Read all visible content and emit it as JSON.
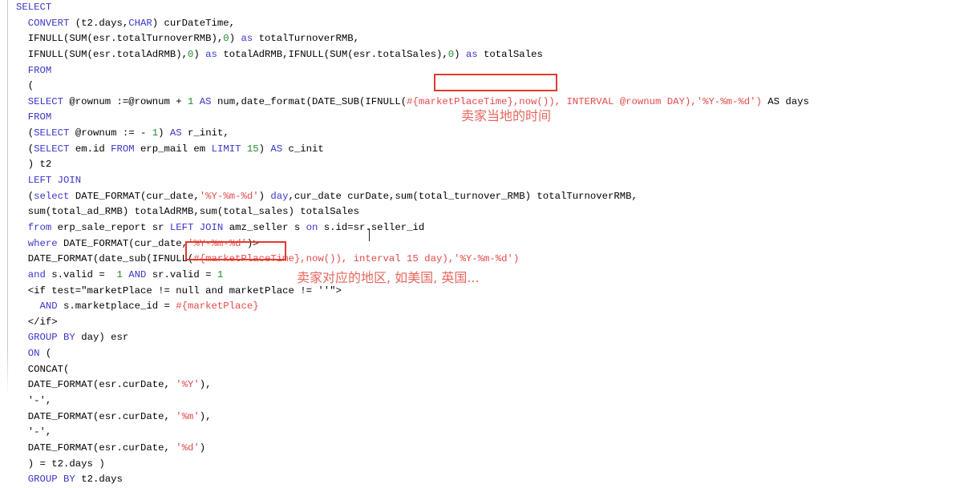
{
  "editor": {
    "language": "SQL / MyBatis XML",
    "background_color": "#ffffff",
    "keyword_color": "#3a36c8",
    "number_color": "#1f8a2e",
    "plain_color": "#000000",
    "placeholder_color": "#e24a4a",
    "annotation_color": "#e7675f",
    "highlight_border_color": "#e23a30"
  },
  "code_lines": [
    {
      "id": "l1",
      "indent": 0,
      "tokens": [
        {
          "t": "SELECT",
          "c": "kw"
        }
      ]
    },
    {
      "id": "l2",
      "indent": 1,
      "tokens": [
        {
          "t": "CONVERT",
          "c": "kw"
        },
        {
          "t": " (t2.days,",
          "c": "pl"
        },
        {
          "t": "CHAR",
          "c": "kw"
        },
        {
          "t": ") curDateTime,",
          "c": "pl"
        }
      ]
    },
    {
      "id": "l3",
      "indent": 1,
      "tokens": [
        {
          "t": "IFNULL(SUM(esr.totalTurnoverRMB),",
          "c": "pl"
        },
        {
          "t": "0",
          "c": "num"
        },
        {
          "t": ") ",
          "c": "pl"
        },
        {
          "t": "as",
          "c": "kw"
        },
        {
          "t": " totalTurnoverRMB,",
          "c": "pl"
        }
      ]
    },
    {
      "id": "l4",
      "indent": 1,
      "tokens": [
        {
          "t": "IFNULL(SUM(esr.totalAdRMB),",
          "c": "pl"
        },
        {
          "t": "0",
          "c": "num"
        },
        {
          "t": ") ",
          "c": "pl"
        },
        {
          "t": "as",
          "c": "kw"
        },
        {
          "t": " totalAdRMB,IFNULL(SUM(esr.totalSales),",
          "c": "pl"
        },
        {
          "t": "0",
          "c": "num"
        },
        {
          "t": ") ",
          "c": "pl"
        },
        {
          "t": "as",
          "c": "kw"
        },
        {
          "t": " totalSales",
          "c": "pl"
        }
      ]
    },
    {
      "id": "l5",
      "indent": 1,
      "tokens": [
        {
          "t": "FROM",
          "c": "kw"
        }
      ]
    },
    {
      "id": "l6",
      "indent": 1,
      "tokens": [
        {
          "t": "(",
          "c": "pl"
        }
      ]
    },
    {
      "id": "l7",
      "indent": 1,
      "tokens": [
        {
          "t": "SELECT",
          "c": "kw"
        },
        {
          "t": " @rownum :=@rownum + ",
          "c": "pl"
        },
        {
          "t": "1",
          "c": "num"
        },
        {
          "t": " ",
          "c": "pl"
        },
        {
          "t": "AS",
          "c": "kw"
        },
        {
          "t": " num,date_format(DATE_SUB(IFNULL(",
          "c": "pl"
        },
        {
          "t": "#{marketPlaceTime}",
          "c": "rd"
        },
        {
          "t": ",now()), ",
          "c": "rd"
        },
        {
          "t": "INTERVAL @rownum DAY),'%Y-%m-%d') ",
          "c": "rd"
        },
        {
          "t": "AS days",
          "c": "pl"
        }
      ]
    },
    {
      "id": "l8",
      "indent": 1,
      "tokens": [
        {
          "t": "FROM",
          "c": "kw"
        }
      ]
    },
    {
      "id": "l9",
      "indent": 1,
      "tokens": [
        {
          "t": "(",
          "c": "pl"
        },
        {
          "t": "SELECT",
          "c": "kw"
        },
        {
          "t": " @rownum := - ",
          "c": "pl"
        },
        {
          "t": "1",
          "c": "num"
        },
        {
          "t": ") ",
          "c": "pl"
        },
        {
          "t": "AS",
          "c": "kw"
        },
        {
          "t": " r_init,",
          "c": "pl"
        }
      ]
    },
    {
      "id": "l10",
      "indent": 1,
      "tokens": [
        {
          "t": "(",
          "c": "pl"
        },
        {
          "t": "SELECT",
          "c": "kw"
        },
        {
          "t": " em.id ",
          "c": "pl"
        },
        {
          "t": "FROM",
          "c": "kw"
        },
        {
          "t": " erp_mail em ",
          "c": "pl"
        },
        {
          "t": "LIMIT",
          "c": "kw"
        },
        {
          "t": " ",
          "c": "pl"
        },
        {
          "t": "15",
          "c": "num"
        },
        {
          "t": ") ",
          "c": "pl"
        },
        {
          "t": "AS",
          "c": "kw"
        },
        {
          "t": " c_init",
          "c": "pl"
        }
      ]
    },
    {
      "id": "l11",
      "indent": 1,
      "tokens": [
        {
          "t": ") t2",
          "c": "pl"
        }
      ]
    },
    {
      "id": "l12",
      "indent": 1,
      "tokens": [
        {
          "t": "LEFT JOIN",
          "c": "kw"
        }
      ]
    },
    {
      "id": "l13",
      "indent": 1,
      "tokens": [
        {
          "t": "(",
          "c": "pl"
        },
        {
          "t": "select",
          "c": "kw"
        },
        {
          "t": " DATE_FORMAT(cur_date,",
          "c": "pl"
        },
        {
          "t": "'%Y-%m-%d'",
          "c": "rd"
        },
        {
          "t": ") ",
          "c": "pl"
        },
        {
          "t": "day",
          "c": "kw"
        },
        {
          "t": ",cur_date curDate,sum(total_turnover_RMB) totalTurnoverRMB,",
          "c": "pl"
        }
      ]
    },
    {
      "id": "l14",
      "indent": 1,
      "tokens": [
        {
          "t": "sum(total_ad_RMB) totalAdRMB,sum(total_sales) totalSales",
          "c": "pl"
        }
      ]
    },
    {
      "id": "l15",
      "indent": 1,
      "tokens": [
        {
          "t": "from",
          "c": "kw"
        },
        {
          "t": " erp_sale_report sr ",
          "c": "pl"
        },
        {
          "t": "LEFT JOIN",
          "c": "kw"
        },
        {
          "t": " amz_seller s ",
          "c": "pl"
        },
        {
          "t": "on",
          "c": "kw"
        },
        {
          "t": " s.id=sr.seller_id",
          "c": "pl"
        }
      ]
    },
    {
      "id": "l16",
      "indent": 1,
      "tokens": [
        {
          "t": "where",
          "c": "kw"
        },
        {
          "t": " DATE_FORMAT(cur_date,",
          "c": "pl"
        },
        {
          "t": "'%Y-%m-%d'",
          "c": "rd"
        },
        {
          "t": ")>",
          "c": "pl"
        }
      ]
    },
    {
      "id": "l17",
      "indent": 1,
      "tokens": [
        {
          "t": "DATE_FORMAT(date_sub(IFNULL(",
          "c": "pl"
        },
        {
          "t": "#{marketPlaceTime},now()), interval 15 day),'%Y-%m-%d')",
          "c": "rd"
        }
      ]
    },
    {
      "id": "l18",
      "indent": 1,
      "tokens": [
        {
          "t": "and",
          "c": "kw"
        },
        {
          "t": " s.valid =  ",
          "c": "pl"
        },
        {
          "t": "1",
          "c": "num"
        },
        {
          "t": " ",
          "c": "pl"
        },
        {
          "t": "AND",
          "c": "kw"
        },
        {
          "t": " sr.valid = ",
          "c": "pl"
        },
        {
          "t": "1",
          "c": "num"
        }
      ]
    },
    {
      "id": "l19",
      "indent": 1,
      "tokens": [
        {
          "t": "<if test=\"marketPlace != null and marketPlace != ''\">",
          "c": "pl"
        }
      ]
    },
    {
      "id": "l20",
      "indent": 2,
      "tokens": [
        {
          "t": "AND",
          "c": "kw"
        },
        {
          "t": " s.marketplace_id = ",
          "c": "pl"
        },
        {
          "t": "#{marketPlace}",
          "c": "rd"
        }
      ]
    },
    {
      "id": "l21",
      "indent": 1,
      "tokens": [
        {
          "t": "</if>",
          "c": "pl"
        }
      ]
    },
    {
      "id": "l22",
      "indent": 1,
      "tokens": [
        {
          "t": "GROUP BY",
          "c": "kw"
        },
        {
          "t": " day) esr",
          "c": "pl"
        }
      ]
    },
    {
      "id": "l23",
      "indent": 1,
      "tokens": [
        {
          "t": "ON",
          "c": "kw"
        },
        {
          "t": " (",
          "c": "pl"
        }
      ]
    },
    {
      "id": "l24",
      "indent": 1,
      "tokens": [
        {
          "t": "CONCAT(",
          "c": "pl"
        }
      ]
    },
    {
      "id": "l25",
      "indent": 1,
      "tokens": [
        {
          "t": "DATE_FORMAT(esr.curDate, ",
          "c": "pl"
        },
        {
          "t": "'%Y'",
          "c": "rd"
        },
        {
          "t": "),",
          "c": "pl"
        }
      ]
    },
    {
      "id": "l26",
      "indent": 1,
      "tokens": [
        {
          "t": "'-',",
          "c": "pl"
        }
      ]
    },
    {
      "id": "l27",
      "indent": 1,
      "tokens": [
        {
          "t": "DATE_FORMAT(esr.curDate, ",
          "c": "pl"
        },
        {
          "t": "'%m'",
          "c": "rd"
        },
        {
          "t": "),",
          "c": "pl"
        }
      ]
    },
    {
      "id": "l28",
      "indent": 1,
      "tokens": [
        {
          "t": "'-',",
          "c": "pl"
        }
      ]
    },
    {
      "id": "l29",
      "indent": 1,
      "tokens": [
        {
          "t": "DATE_FORMAT(esr.curDate, ",
          "c": "pl"
        },
        {
          "t": "'%d'",
          "c": "rd"
        },
        {
          "t": ")",
          "c": "pl"
        }
      ]
    },
    {
      "id": "l30",
      "indent": 1,
      "tokens": [
        {
          "t": ") = t2.days )",
          "c": "pl"
        }
      ]
    },
    {
      "id": "l31",
      "indent": 1,
      "tokens": [
        {
          "t": "GROUP BY",
          "c": "kw"
        },
        {
          "t": " t2.days",
          "c": "pl"
        }
      ]
    }
  ],
  "highlights": [
    {
      "id": "marketPlaceTime",
      "text": "#{marketPlaceTime}",
      "line": "l7"
    },
    {
      "id": "marketPlace",
      "text": "#{marketPlace}",
      "line": "l20"
    }
  ],
  "annotations": {
    "seller_local_time": "卖家当地的时间",
    "seller_region": "卖家对应的地区, 如美国, 英国..."
  }
}
